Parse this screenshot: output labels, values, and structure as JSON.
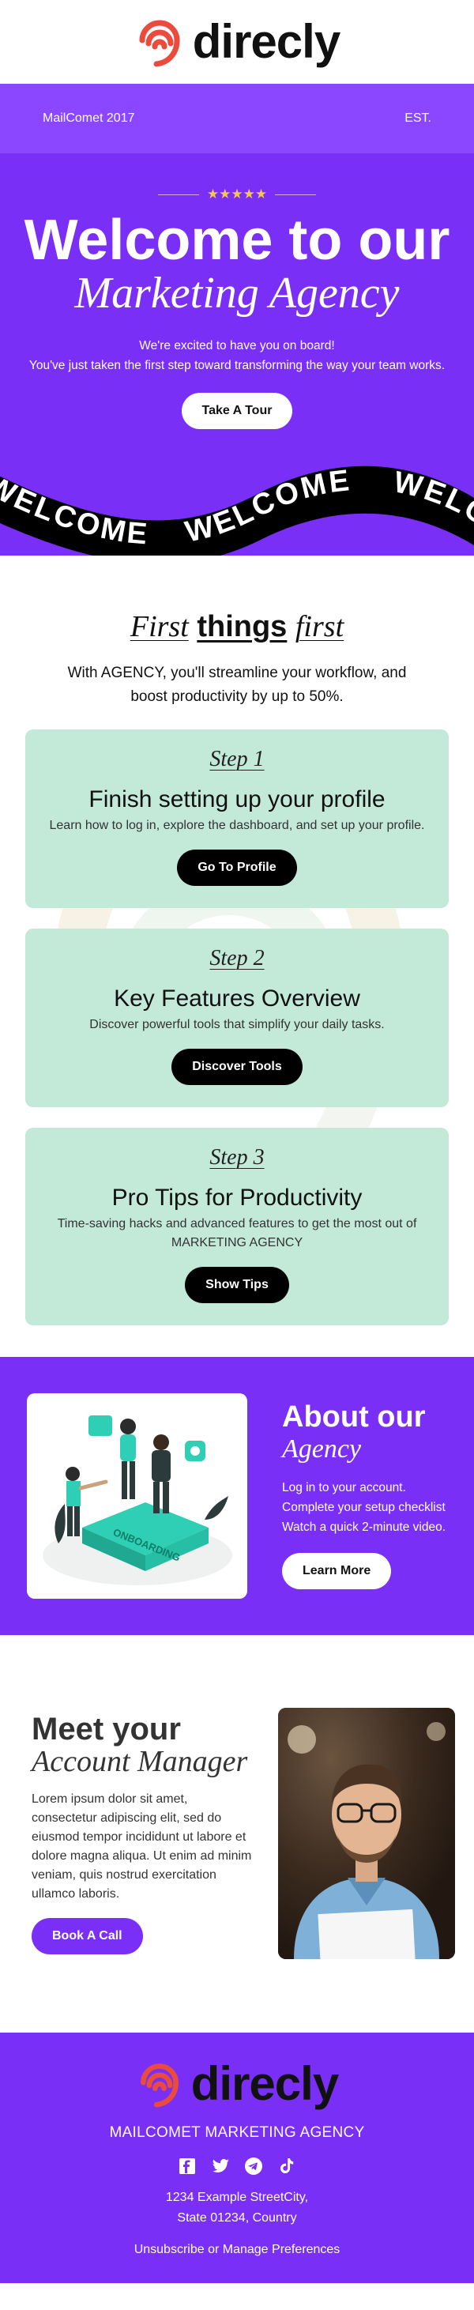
{
  "brand": {
    "name": "direcly",
    "colors": {
      "purple": "#7a2ff7",
      "purple_light": "#8b47ff",
      "mint": "#c3e9d9",
      "logo": "#ea4b3c",
      "star": "#f2c94c"
    }
  },
  "hero": {
    "left_tag": "MailComet 2017",
    "right_tag": "EST.",
    "stars": "★★★★★",
    "title": "Welcome to our",
    "subtitle": "Marketing Agency",
    "desc_line1": "We're excited to have you on board!",
    "desc_line2": "You've just taken the first step toward transforming the way your team works.",
    "button": "Take A Tour",
    "ribbon_text": "WELCOME"
  },
  "first": {
    "title_word1": "First",
    "title_word2": "things",
    "title_word3": "first",
    "desc": "With AGENCY, you'll streamline your workflow, and boost productivity by up to 50%.",
    "steps": [
      {
        "label": "Step 1",
        "title": "Finish setting up your profile",
        "desc": "Learn how to log in, explore the dashboard, and set up your profile.",
        "button": "Go To Profile"
      },
      {
        "label": "Step 2",
        "title": "Key Features Overview",
        "desc": "Discover powerful tools that simplify your daily tasks.",
        "button": "Discover Tools"
      },
      {
        "label": "Step 3",
        "title": "Pro Tips for Productivity",
        "desc": "Time-saving hacks and advanced features to get the most out of MARKETING AGENCY",
        "button": "Show Tips"
      }
    ]
  },
  "about": {
    "title": "About our",
    "subtitle": "Agency",
    "items": [
      "Log in to your account.",
      "Complete your setup checklist",
      "Watch a quick 2-minute video."
    ],
    "button": "Learn More",
    "image_text": "ONBOARDING"
  },
  "meet": {
    "title": "Meet your",
    "subtitle": "Account Manager",
    "desc": "Lorem ipsum dolor sit amet, consectetur adipiscing elit, sed do eiusmod tempor incididunt ut labore et dolore magna aliqua. Ut enim ad minim veniam, quis nostrud exercitation ullamco laboris.",
    "button": "Book A Call"
  },
  "footer": {
    "agency": "MAILCOMET MARKETING AGENCY",
    "address_line1": "1234 Example StreetCity,",
    "address_line2": "State 01234, Country",
    "links": "Unsubscribe or Manage Preferences",
    "socials": [
      "facebook-icon",
      "twitter-icon",
      "telegram-icon",
      "tiktok-icon"
    ]
  }
}
